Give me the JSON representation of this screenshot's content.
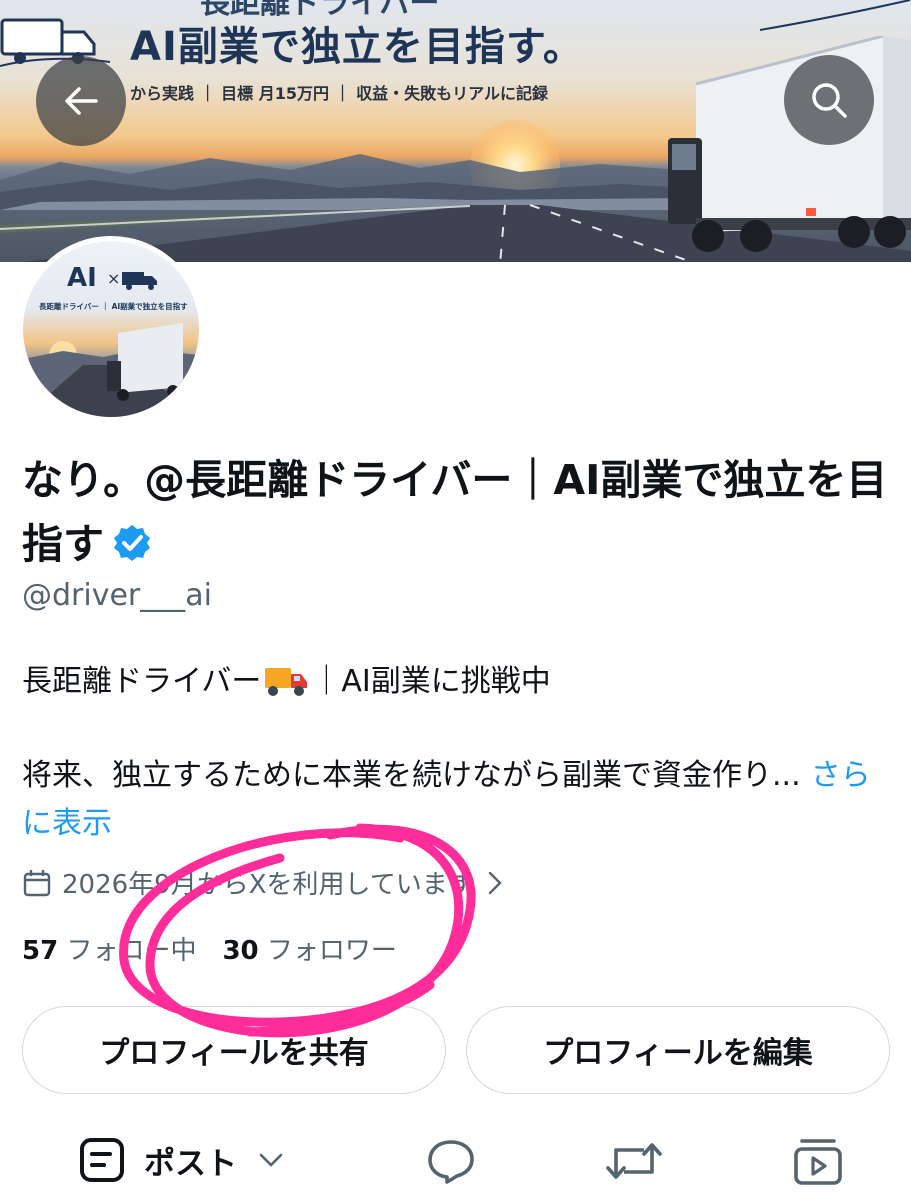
{
  "banner": {
    "title": "AI副業で独立を目指す。",
    "title_top_cut": "長距離ドライバー",
    "subtitle": "から実践 ｜ 目標 月15万円 ｜ 収益・失敗もリアルに記録"
  },
  "avatar": {
    "ai_text": "AI",
    "x_text": "×",
    "caption": "長距離ドライバー ｜ AI副業で独立を目指す"
  },
  "profile": {
    "name": "なり。@長距離ドライバー｜AI副業で独立を目指す",
    "handle": "@driver___ai",
    "bio_line1_a": "長距離ドライバー",
    "bio_line1_b": "｜AI副業に挑戦中",
    "bio_line2": "将来、独立するために本業を続けながら副業で資金作り...",
    "show_more": "さらに表示",
    "joined": "2026年9月からXを利用しています",
    "following_count": "57",
    "following_label": "フォロー中",
    "followers_count": "30",
    "followers_label": "フォロワー"
  },
  "buttons": {
    "share": "プロフィールを共有",
    "edit": "プロフィールを編集"
  },
  "tabs": {
    "posts": "ポスト"
  },
  "colors": {
    "link": "#1d9bf0",
    "verified": "#1d9bf0",
    "annotation": "#ff2d9a",
    "secondary_text": "#536471"
  },
  "icons": [
    "back-arrow-icon",
    "search-icon",
    "verified-badge-icon",
    "truck-emoji-icon",
    "calendar-icon",
    "chevron-right-icon",
    "posts-icon",
    "chevron-down-icon",
    "reply-icon",
    "repost-icon",
    "video-icon"
  ]
}
